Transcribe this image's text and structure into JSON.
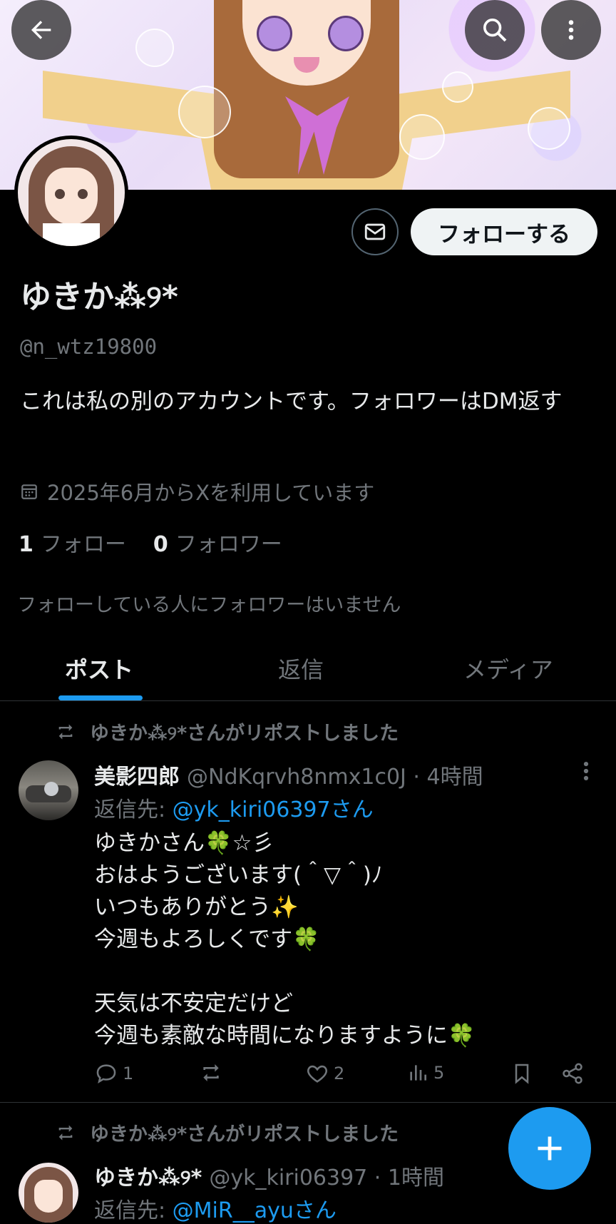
{
  "profile": {
    "display_name": "ゆきか⁂୨*",
    "handle": "@n_wtz19800",
    "bio": "これは私の別のアカウントです。フォロワーはDM返す",
    "joined": "2025年6月からXを利用しています",
    "following_count": "1",
    "following_label": "フォロー",
    "followers_count": "0",
    "followers_label": "フォロワー",
    "followed_by_note": "フォローしている人にフォロワーはいません",
    "follow_button": "フォローする"
  },
  "tabs": [
    "ポスト",
    "返信",
    "メディア"
  ],
  "posts": [
    {
      "repost_note": "ゆきか⁂୨*さんがリポストしました",
      "author": "美影四郎",
      "handle": "@NdKqrvh8nmx1c0J · 4時間",
      "reply_prefix": "返信先: ",
      "reply_mention": "@yk_kiri06397さん",
      "body": "ゆきかさん🍀☆彡\nおはようございます(＾▽＾)ﾉ\nいつもありがとう✨\n今週もよろしくです🍀\n\n天気は不安定だけど\n今週も素敵な時間になりますように🍀",
      "replies": "1",
      "reposts": "",
      "likes": "2",
      "views": "5"
    },
    {
      "repost_note": "ゆきか⁂୨*さんがリポストしました",
      "author": "ゆきか⁂୨*",
      "handle": "@yk_kiri06397 · 1時間",
      "reply_prefix": "返信先: ",
      "reply_mention": "@MiR__ayuさん"
    }
  ],
  "icons": [
    "back-arrow-icon",
    "search-icon",
    "more-vertical-icon",
    "mail-icon",
    "calendar-icon",
    "repost-icon",
    "reply-icon",
    "like-icon",
    "views-icon",
    "bookmark-icon",
    "share-icon",
    "compose-plus-icon"
  ],
  "colors": {
    "accent": "#1d9bf0",
    "background": "#000000",
    "muted": "#71767b"
  }
}
